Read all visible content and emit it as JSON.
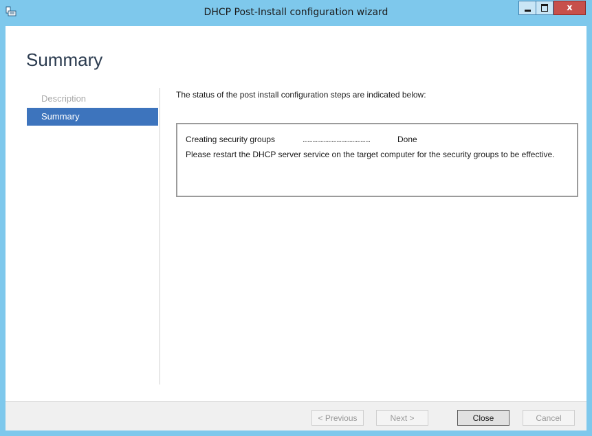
{
  "window": {
    "title": "DHCP Post-Install configuration wizard",
    "icon": "wizard-app-icon",
    "controls": {
      "minimize": "minimize-icon",
      "maximize": "maximize-icon",
      "close": "x"
    },
    "colors": {
      "titlebar": "#7ec8ec",
      "close_button": "#c7504b",
      "nav_active": "#3d74bd"
    }
  },
  "page": {
    "heading": "Summary"
  },
  "nav": {
    "items": [
      {
        "label": "Description",
        "state": "disabled"
      },
      {
        "label": "Summary",
        "state": "active"
      }
    ]
  },
  "main": {
    "intro": "The status of the post install configuration steps are indicated below:",
    "status": {
      "step": "Creating security groups",
      "dots": "..........................................",
      "result": "Done",
      "message": "Please restart the DHCP server service on the target computer for the security groups to be effective."
    }
  },
  "footer": {
    "previous": "< Previous",
    "next": "Next >",
    "close": "Close",
    "cancel": "Cancel"
  }
}
